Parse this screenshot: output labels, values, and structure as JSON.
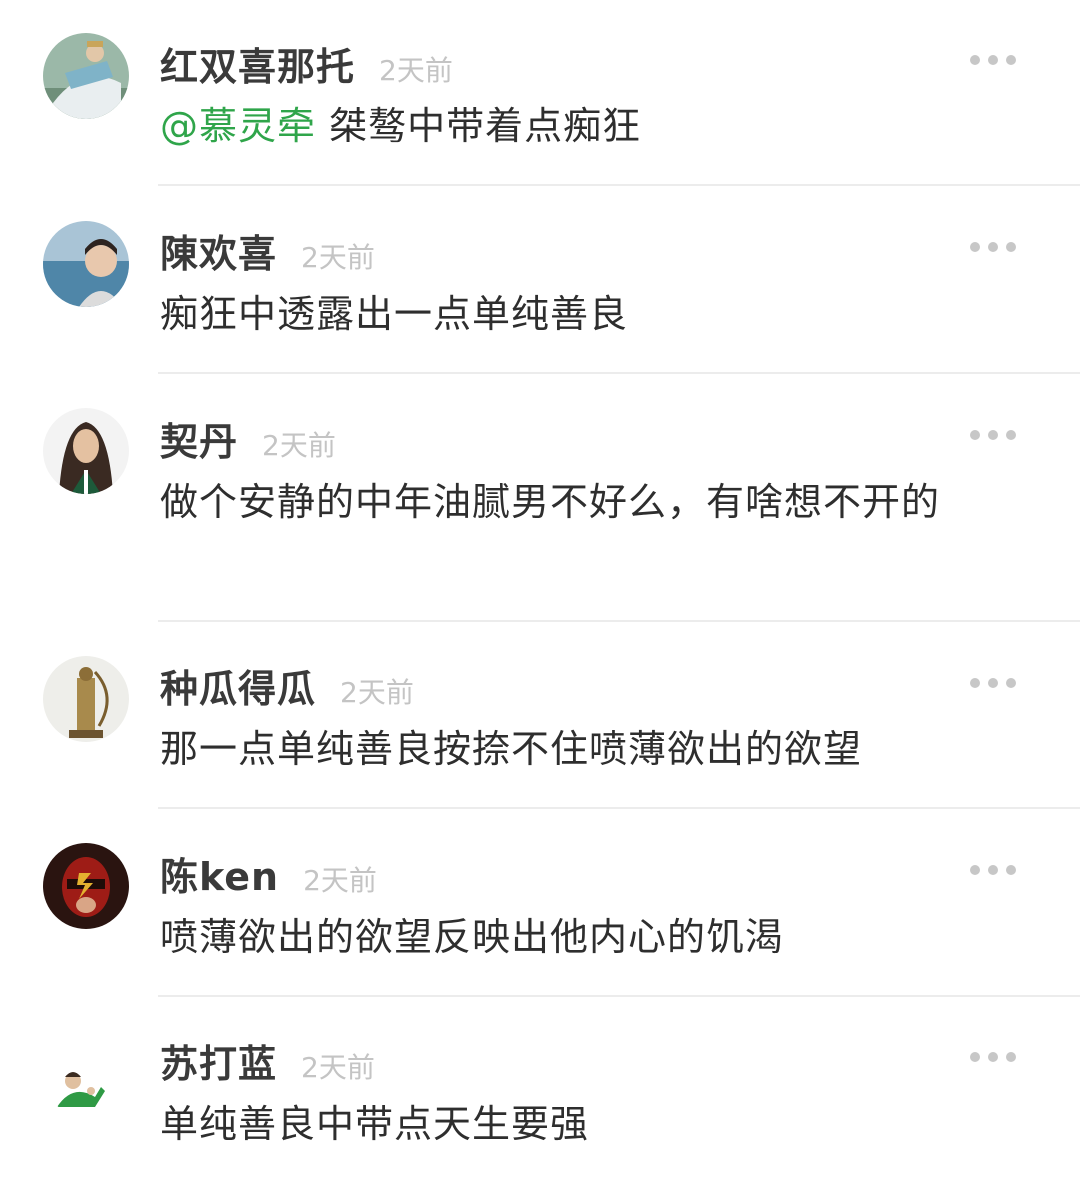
{
  "comments": [
    {
      "nickname": "红双喜那托",
      "time": "2天前",
      "mention": "@慕灵牵",
      "text": " 桀骜中带着点痴狂"
    },
    {
      "nickname": "陳欢喜",
      "time": "2天前",
      "text": "痴狂中透露出一点单纯善良"
    },
    {
      "nickname": "契丹",
      "time": "2天前",
      "text": "做个安静的中年油腻男不好么，有啥想不开的"
    },
    {
      "nickname": "种瓜得瓜",
      "time": "2天前",
      "text": "那一点单纯善良按捺不住喷薄欲出的欲望"
    },
    {
      "nickname": "陈ken",
      "time": "2天前",
      "text": "喷薄欲出的欲望反映出他内心的饥渴"
    },
    {
      "nickname": "苏打蓝",
      "time": "2天前",
      "text": "单纯善良中带点天生要强"
    }
  ],
  "icons": {
    "more": "more-dots-icon"
  },
  "colors": {
    "mention": "#2fa54a",
    "time": "#c4c4c4",
    "divider": "#ececec"
  }
}
